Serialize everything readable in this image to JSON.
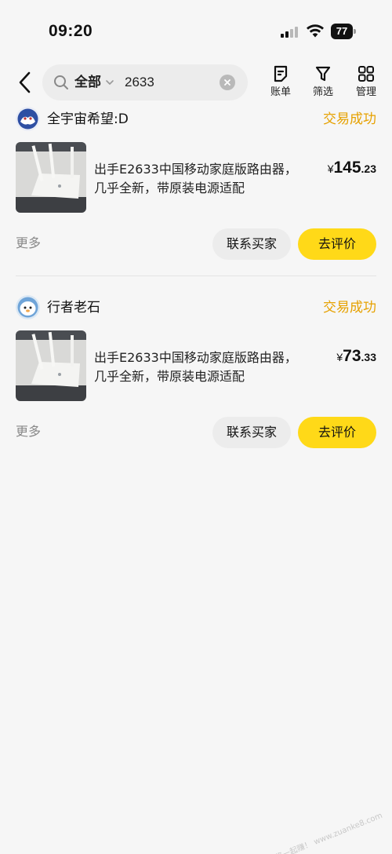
{
  "status_bar": {
    "time": "09:20",
    "battery": "77",
    "icons": [
      "cellular-signal-icon",
      "wifi-icon",
      "battery-icon"
    ]
  },
  "header": {
    "search": {
      "scope": "全部",
      "query": "2633"
    },
    "tools": [
      {
        "label": "账单",
        "icon": "bill-icon"
      },
      {
        "label": "筛选",
        "icon": "filter-icon"
      },
      {
        "label": "管理",
        "icon": "grid-manage-icon"
      }
    ]
  },
  "orders": [
    {
      "seller": "全宇宙希望:D",
      "status": "交易成功",
      "title": "出手E2633中国移动家庭版路由器，几乎全新，带原装电源适配",
      "price_symbol": "¥",
      "price_int": "145",
      "price_dec": ".23",
      "more": "更多",
      "contact_label": "联系买家",
      "review_label": "去评价"
    },
    {
      "seller": "行者老石",
      "status": "交易成功",
      "title": "出手E2633中国移动家庭版路由器，几乎全新，带原装电源适配",
      "price_symbol": "¥",
      "price_int": "73",
      "price_dec": ".33",
      "more": "更多",
      "contact_label": "联系买家",
      "review_label": "去评价"
    }
  ],
  "watermark": "赚客吧，有奖一起赚！ www.zuanke8.com",
  "colors": {
    "accent_yellow": "#ffd918",
    "status_orange": "#e6a100",
    "background": "#f6f6f6"
  }
}
